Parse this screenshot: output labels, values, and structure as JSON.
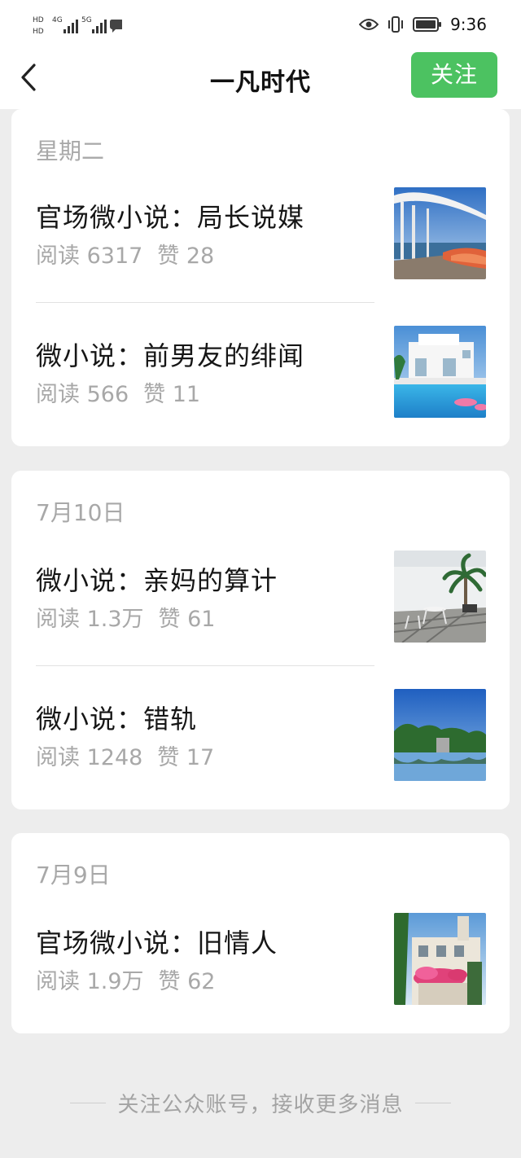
{
  "status_bar": {
    "left_labels": [
      "HD",
      "4G",
      "HD",
      "5G"
    ],
    "time": "9:36"
  },
  "nav": {
    "title": "一凡时代",
    "follow_label": "关注"
  },
  "groups": [
    {
      "date": "星期二",
      "articles": [
        {
          "title": "官场微小说：局长说媒",
          "reads": "阅读 6317",
          "likes": "赞 28"
        },
        {
          "title": "微小说：前男友的绯闻",
          "reads": "阅读 566",
          "likes": "赞 11"
        }
      ]
    },
    {
      "date": "7月10日",
      "articles": [
        {
          "title": "微小说：亲妈的算计",
          "reads": "阅读 1.3万",
          "likes": "赞 61"
        },
        {
          "title": "微小说：错轨",
          "reads": "阅读 1248",
          "likes": "赞 17"
        }
      ]
    },
    {
      "date": "7月9日",
      "articles": [
        {
          "title": "官场微小说：旧情人",
          "reads": "阅读 1.9万",
          "likes": "赞 62"
        }
      ]
    }
  ],
  "footer": {
    "text": "关注公众账号，接收更多消息"
  },
  "colors": {
    "accent": "#4cc261",
    "background": "#ededed",
    "muted_text": "#a8a8a8"
  }
}
